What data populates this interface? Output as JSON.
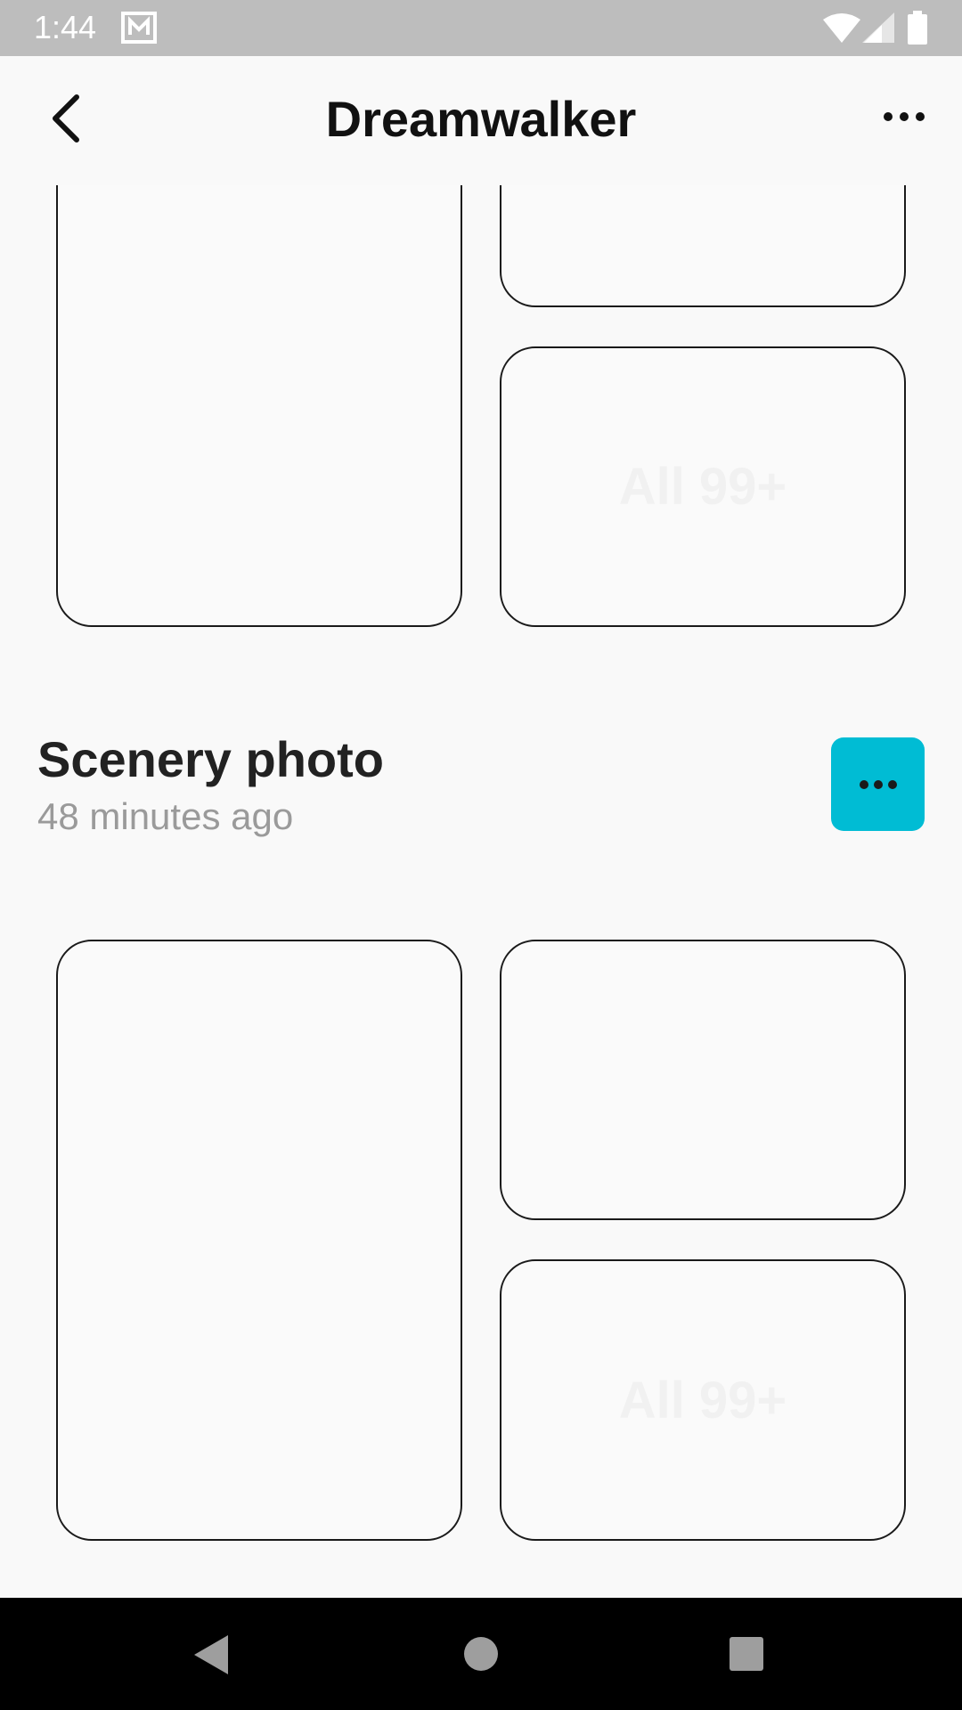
{
  "status_bar": {
    "time": "1:44"
  },
  "header": {
    "title": "Dreamwalker"
  },
  "albums": [
    {
      "count_label": "All 99+"
    },
    {
      "title": "Scenery photo",
      "subtitle": "48 minutes ago",
      "count_label": "All 99+"
    }
  ],
  "colors": {
    "accent": "#00bcd4",
    "status_bar": "#bdbdbd",
    "nav_bar": "#000000",
    "background": "#f9f9f9"
  },
  "icons": {
    "status": [
      "mail-icon",
      "wifi-icon",
      "signal-icon",
      "battery-icon"
    ],
    "header": [
      "back-arrow-icon",
      "more-dots-icon"
    ],
    "nav": [
      "nav-back-icon",
      "nav-home-icon",
      "nav-recents-icon"
    ]
  }
}
